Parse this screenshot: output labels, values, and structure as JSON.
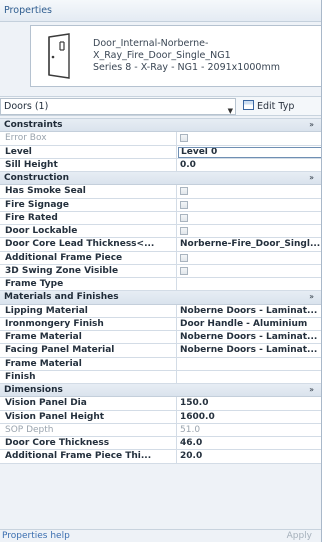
{
  "window": {
    "title": "Properties"
  },
  "type_selector": {
    "line1": "Door_Internal-Norberne-",
    "line2": "X_Ray_Fire_Door_Single_NG1",
    "line3": "Series 8 - X-Ray - NG1 - 2091x1000mm"
  },
  "instance_filter": {
    "value": "Doors (1)"
  },
  "edit_type": {
    "label": "Edit Typ"
  },
  "groups": {
    "constraints": "Constraints",
    "construction": "Construction",
    "materials": "Materials and Finishes",
    "dimensions": "Dimensions",
    "collapse_glyph": "»"
  },
  "params": {
    "error_box": {
      "name": "Error Box"
    },
    "level": {
      "name": "Level",
      "value": "Level 0"
    },
    "sill_height": {
      "name": "Sill Height",
      "value": "0.0"
    },
    "has_smoke_seal": {
      "name": "Has Smoke Seal"
    },
    "fire_signage": {
      "name": "Fire Signage"
    },
    "fire_rated": {
      "name": "Fire Rated"
    },
    "door_lockable": {
      "name": "Door Lockable"
    },
    "door_core_lead": {
      "name": "Door Core Lead Thickness<...",
      "value": "Norberne-Fire_Door_Singl..."
    },
    "additional_frame_piece": {
      "name": "Additional Frame Piece"
    },
    "swing_zone": {
      "name": "3D Swing Zone Visible"
    },
    "frame_type": {
      "name": "Frame Type",
      "value": ""
    },
    "lipping_material": {
      "name": "Lipping Material",
      "value": "Noberne Doors - Laminat..."
    },
    "ironmongery_finish": {
      "name": "Ironmongery Finish",
      "value": "Door Handle - Aluminium"
    },
    "frame_material": {
      "name": "Frame Material",
      "value": "Noberne Doors - Laminat..."
    },
    "facing_panel_material": {
      "name": "Facing Panel Material",
      "value": "Noberne Doors - Laminat..."
    },
    "frame_material_2": {
      "name": "Frame Material",
      "value": ""
    },
    "finish": {
      "name": "Finish",
      "value": ""
    },
    "vision_panel_dia": {
      "name": "Vision Panel Dia",
      "value": "150.0"
    },
    "vision_panel_height": {
      "name": "Vision Panel Height",
      "value": "1600.0"
    },
    "sop_depth": {
      "name": "SOP Depth",
      "value": "51.0"
    },
    "door_core_thickness": {
      "name": "Door Core Thickness",
      "value": "46.0"
    },
    "additional_frame_piece_thi": {
      "name": "Additional Frame Piece Thi...",
      "value": "20.0"
    }
  },
  "footer": {
    "help": "Properties help",
    "apply": "Apply"
  },
  "icons": {
    "door_preview": "door-icon",
    "edit_type": "edit-type-icon",
    "dropdown": "chevron-down-icon"
  }
}
